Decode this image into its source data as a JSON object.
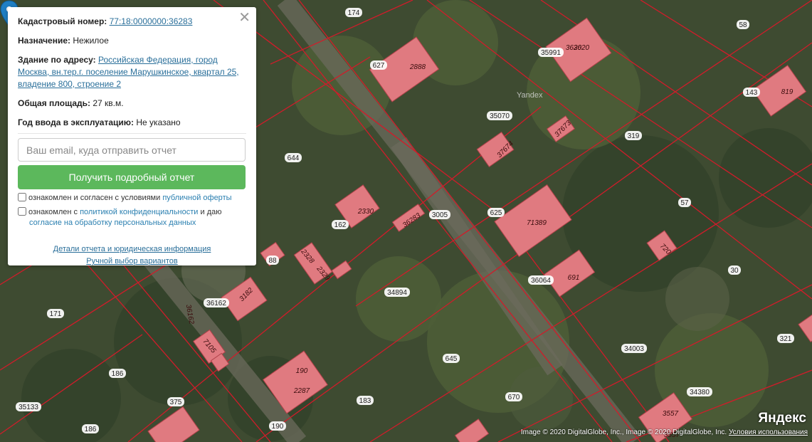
{
  "popup": {
    "cadastral_label": "Кадастровый номер:",
    "cadastral_value": "77:18:0000000:36283",
    "purpose_label": "Назначение:",
    "purpose_value": "Нежилое",
    "address_label": "Здание по адресу:",
    "address_value": "Российская Федерация, город Москва, вн.тер.г. поселение Марушкинское, квартал 25, владение 800, строение 2",
    "area_label": "Общая площадь:",
    "area_value": "27 кв.м.",
    "year_label": "Год ввода в эксплуатацию:",
    "year_value": "Не указано",
    "email_placeholder": "Ваш email, куда отправить отчет",
    "submit_label": "Получить подробный отчет",
    "consent1_text": "ознакомлен и согласен с условиями",
    "consent1_link": "публичной оферты",
    "consent2_text_a": "ознакомлен с",
    "consent2_link_a": "политикой конфиденциальности",
    "consent2_text_b": "и даю",
    "consent2_link_b": "согласие на обработку персональных данных",
    "details_link": "Детали отчета и юридическая информация",
    "manual_link": "Ручной выбор вариантов",
    "close_icon": "close-icon"
  },
  "map": {
    "watermark": "Yandex",
    "logo": "Яндекс",
    "attribution": "Image © 2020 DigitalGlobe, Inc., Image © 2020 DigitalGlobe, Inc.",
    "terms_link": "Условия использования",
    "pin_icon": "map-marker-icon",
    "pin_color": "#1f7fc4",
    "parcel_line_color": "#d01c2a",
    "building_fill": "#e07a80",
    "parcel_labels": [
      "174",
      "627",
      "35991",
      "58",
      "143",
      "35070",
      "319",
      "644",
      "162",
      "3005",
      "625",
      "57",
      "88",
      "34894",
      "36064",
      "30",
      "171",
      "36162",
      "186",
      "645",
      "34003",
      "670",
      "183",
      "190",
      "375",
      "35133",
      "186",
      "34380",
      "321"
    ],
    "building_labels": [
      "2888",
      "3620",
      "3620",
      "819",
      "37673",
      "37674",
      "2330",
      "36283",
      "71389",
      "720",
      "2328",
      "2329",
      "3182",
      "691",
      "36162",
      "7105",
      "190",
      "2287",
      "3557",
      "3557"
    ]
  }
}
